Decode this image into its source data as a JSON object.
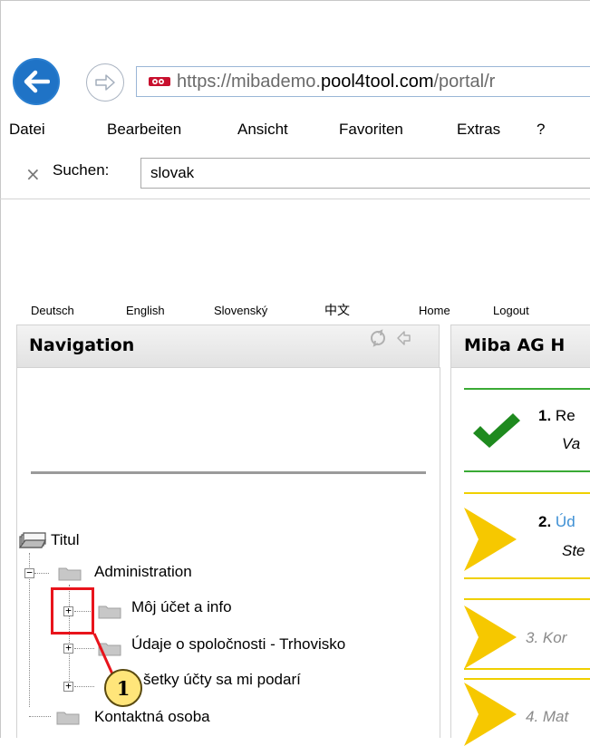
{
  "browser": {
    "url": {
      "scheme": "https://",
      "subdomain": "mibademo.",
      "domain": "pool4tool.com",
      "path": "/portal/r"
    },
    "menu": [
      "Datei",
      "Bearbeiten",
      "Ansicht",
      "Favoriten",
      "Extras",
      "?"
    ],
    "find": {
      "close_icon": "×",
      "label": "Suchen:",
      "value": "slovak"
    }
  },
  "page": {
    "languages": [
      "Deutsch",
      "English",
      "Slovenský",
      "中文"
    ],
    "links": [
      "Home",
      "Logout"
    ],
    "navigation": {
      "title": "Navigation",
      "tree": {
        "root": "Titul",
        "items": [
          {
            "label": "Administration",
            "toggle": "−"
          },
          {
            "label": "Môj účet a info",
            "toggle": "+"
          },
          {
            "label": "Údaje o spoločnosti - Trhovisko",
            "toggle": "+"
          },
          {
            "label": "šetky účty sa mi podarí",
            "toggle": "+"
          },
          {
            "label": "Kontaktná osoba"
          }
        ]
      }
    },
    "main": {
      "title": "Miba AG H",
      "steps": [
        {
          "num": "1.",
          "title": "Re",
          "sub": "Va",
          "status": "done"
        },
        {
          "num": "2.",
          "title": "Úd",
          "sub": "Ste",
          "status": "current"
        },
        {
          "num": "",
          "title": "3. Kor",
          "sub": "",
          "status": "pending"
        },
        {
          "num": "",
          "title": "4. Mat",
          "sub": "",
          "status": "pending"
        }
      ]
    },
    "callout": {
      "number": "1"
    }
  },
  "colors": {
    "back_button": "#1f73c6",
    "link_blue": "#3d8fd4",
    "green_line": "#3aaa35",
    "yellow_line": "#f0d000",
    "callout_red": "#e8141c"
  }
}
